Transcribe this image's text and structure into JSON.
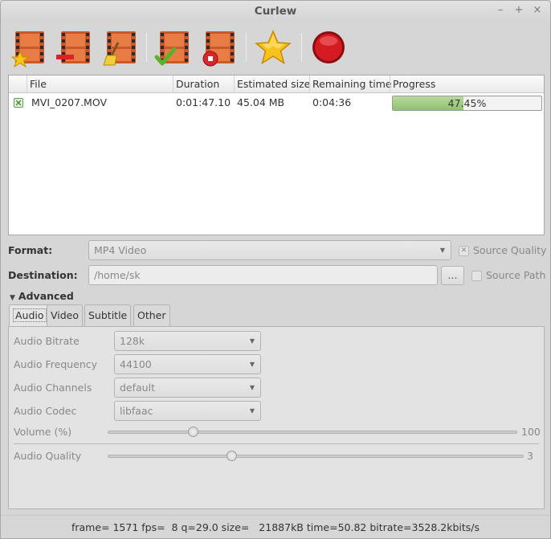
{
  "window": {
    "title": "Curlew",
    "minimize": "–",
    "maximize": "+",
    "close": "×"
  },
  "toolbar": {
    "buttons": [
      {
        "name": "add-file-button",
        "icon": "film-star-icon"
      },
      {
        "name": "remove-file-button",
        "icon": "film-minus-icon"
      },
      {
        "name": "clear-list-button",
        "icon": "film-broom-icon"
      },
      {
        "name": "convert-button",
        "icon": "film-check-icon"
      },
      {
        "name": "stop-button",
        "icon": "film-stop-icon"
      },
      {
        "name": "preferences-button",
        "icon": "star-icon"
      },
      {
        "name": "quit-button",
        "icon": "record-icon"
      }
    ],
    "accent": "#c8101a"
  },
  "filelist": {
    "headers": {
      "file": "File",
      "duration": "Duration",
      "size": "Estimated size",
      "remaining": "Remaining time",
      "progress": "Progress"
    },
    "rows": [
      {
        "file": "MVI_0207.MOV",
        "duration": "0:01:47.10",
        "size": "45.04 MB",
        "remaining": "0:04:36",
        "progress_text": "47.45%",
        "progress": 0.4745
      }
    ]
  },
  "format": {
    "label": "Format:",
    "value": "MP4 Video",
    "source_quality": "Source Quality"
  },
  "destination": {
    "label": "Destination:",
    "value": "/home/sk",
    "browse": "...",
    "source_path": "Source Path"
  },
  "advanced": {
    "label": "Advanced",
    "tabs": [
      "Audio",
      "Video",
      "Subtitle",
      "Other"
    ],
    "audio": {
      "bitrate_label": "Audio Bitrate",
      "bitrate": "128k",
      "frequency_label": "Audio Frequency",
      "frequency": "44100",
      "channels_label": "Audio Channels",
      "channels": "default",
      "codec_label": "Audio Codec",
      "codec": "libfaac",
      "volume_label": "Volume (%)",
      "volume": "100",
      "volume_level": 0.21,
      "quality_label": "Audio Quality",
      "quality": "3",
      "quality_level": 0.3
    }
  },
  "status": "frame= 1571 fps=  8 q=29.0 size=   21887kB time=50.82 bitrate=3528.2kbits/s"
}
